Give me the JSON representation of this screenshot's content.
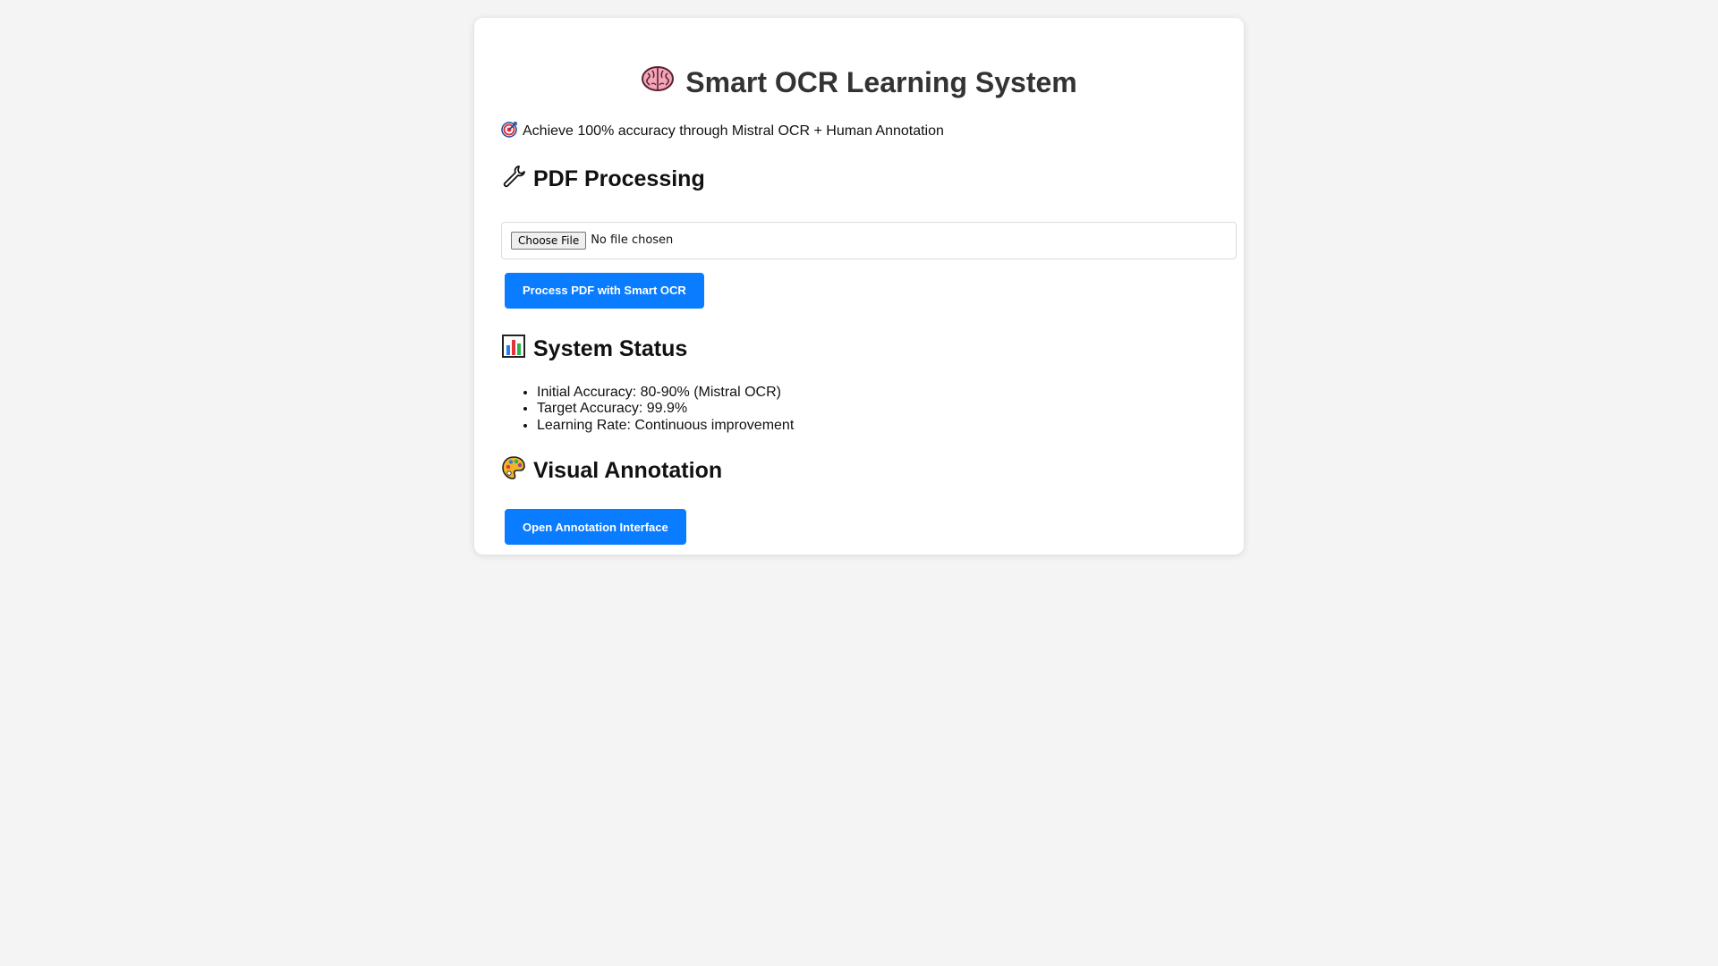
{
  "header": {
    "title": "Smart OCR Learning System",
    "title_icon": "brain-icon",
    "tagline": "Achieve 100% accuracy through Mistral OCR + Human Annotation",
    "tagline_icon": "target-icon"
  },
  "pdf_section": {
    "heading": "PDF Processing",
    "heading_icon": "wrench-icon",
    "file_input": {
      "button_label": "Choose File",
      "status": "No file chosen"
    },
    "process_button": "Process PDF with Smart OCR"
  },
  "status_section": {
    "heading": "System Status",
    "heading_icon": "bar-chart-icon",
    "items": [
      "Initial Accuracy: 80-90% (Mistral OCR)",
      "Target Accuracy: 99.9%",
      "Learning Rate: Continuous improvement"
    ]
  },
  "annotation_section": {
    "heading": "Visual Annotation",
    "heading_icon": "palette-icon",
    "open_button": "Open Annotation Interface"
  },
  "colors": {
    "background": "#f4f4f4",
    "card": "#ffffff",
    "primary_button": "#0a7cff",
    "title_text": "#333333"
  }
}
